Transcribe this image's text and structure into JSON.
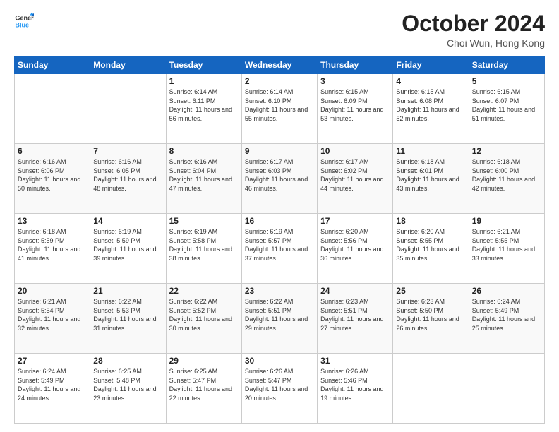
{
  "header": {
    "logo_line1": "General",
    "logo_line2": "Blue",
    "month": "October 2024",
    "location": "Choi Wun, Hong Kong"
  },
  "days_of_week": [
    "Sunday",
    "Monday",
    "Tuesday",
    "Wednesday",
    "Thursday",
    "Friday",
    "Saturday"
  ],
  "weeks": [
    [
      {
        "day": "",
        "info": ""
      },
      {
        "day": "",
        "info": ""
      },
      {
        "day": "1",
        "info": "Sunrise: 6:14 AM\nSunset: 6:11 PM\nDaylight: 11 hours and 56 minutes."
      },
      {
        "day": "2",
        "info": "Sunrise: 6:14 AM\nSunset: 6:10 PM\nDaylight: 11 hours and 55 minutes."
      },
      {
        "day": "3",
        "info": "Sunrise: 6:15 AM\nSunset: 6:09 PM\nDaylight: 11 hours and 53 minutes."
      },
      {
        "day": "4",
        "info": "Sunrise: 6:15 AM\nSunset: 6:08 PM\nDaylight: 11 hours and 52 minutes."
      },
      {
        "day": "5",
        "info": "Sunrise: 6:15 AM\nSunset: 6:07 PM\nDaylight: 11 hours and 51 minutes."
      }
    ],
    [
      {
        "day": "6",
        "info": "Sunrise: 6:16 AM\nSunset: 6:06 PM\nDaylight: 11 hours and 50 minutes."
      },
      {
        "day": "7",
        "info": "Sunrise: 6:16 AM\nSunset: 6:05 PM\nDaylight: 11 hours and 48 minutes."
      },
      {
        "day": "8",
        "info": "Sunrise: 6:16 AM\nSunset: 6:04 PM\nDaylight: 11 hours and 47 minutes."
      },
      {
        "day": "9",
        "info": "Sunrise: 6:17 AM\nSunset: 6:03 PM\nDaylight: 11 hours and 46 minutes."
      },
      {
        "day": "10",
        "info": "Sunrise: 6:17 AM\nSunset: 6:02 PM\nDaylight: 11 hours and 44 minutes."
      },
      {
        "day": "11",
        "info": "Sunrise: 6:18 AM\nSunset: 6:01 PM\nDaylight: 11 hours and 43 minutes."
      },
      {
        "day": "12",
        "info": "Sunrise: 6:18 AM\nSunset: 6:00 PM\nDaylight: 11 hours and 42 minutes."
      }
    ],
    [
      {
        "day": "13",
        "info": "Sunrise: 6:18 AM\nSunset: 5:59 PM\nDaylight: 11 hours and 41 minutes."
      },
      {
        "day": "14",
        "info": "Sunrise: 6:19 AM\nSunset: 5:59 PM\nDaylight: 11 hours and 39 minutes."
      },
      {
        "day": "15",
        "info": "Sunrise: 6:19 AM\nSunset: 5:58 PM\nDaylight: 11 hours and 38 minutes."
      },
      {
        "day": "16",
        "info": "Sunrise: 6:19 AM\nSunset: 5:57 PM\nDaylight: 11 hours and 37 minutes."
      },
      {
        "day": "17",
        "info": "Sunrise: 6:20 AM\nSunset: 5:56 PM\nDaylight: 11 hours and 36 minutes."
      },
      {
        "day": "18",
        "info": "Sunrise: 6:20 AM\nSunset: 5:55 PM\nDaylight: 11 hours and 35 minutes."
      },
      {
        "day": "19",
        "info": "Sunrise: 6:21 AM\nSunset: 5:55 PM\nDaylight: 11 hours and 33 minutes."
      }
    ],
    [
      {
        "day": "20",
        "info": "Sunrise: 6:21 AM\nSunset: 5:54 PM\nDaylight: 11 hours and 32 minutes."
      },
      {
        "day": "21",
        "info": "Sunrise: 6:22 AM\nSunset: 5:53 PM\nDaylight: 11 hours and 31 minutes."
      },
      {
        "day": "22",
        "info": "Sunrise: 6:22 AM\nSunset: 5:52 PM\nDaylight: 11 hours and 30 minutes."
      },
      {
        "day": "23",
        "info": "Sunrise: 6:22 AM\nSunset: 5:51 PM\nDaylight: 11 hours and 29 minutes."
      },
      {
        "day": "24",
        "info": "Sunrise: 6:23 AM\nSunset: 5:51 PM\nDaylight: 11 hours and 27 minutes."
      },
      {
        "day": "25",
        "info": "Sunrise: 6:23 AM\nSunset: 5:50 PM\nDaylight: 11 hours and 26 minutes."
      },
      {
        "day": "26",
        "info": "Sunrise: 6:24 AM\nSunset: 5:49 PM\nDaylight: 11 hours and 25 minutes."
      }
    ],
    [
      {
        "day": "27",
        "info": "Sunrise: 6:24 AM\nSunset: 5:49 PM\nDaylight: 11 hours and 24 minutes."
      },
      {
        "day": "28",
        "info": "Sunrise: 6:25 AM\nSunset: 5:48 PM\nDaylight: 11 hours and 23 minutes."
      },
      {
        "day": "29",
        "info": "Sunrise: 6:25 AM\nSunset: 5:47 PM\nDaylight: 11 hours and 22 minutes."
      },
      {
        "day": "30",
        "info": "Sunrise: 6:26 AM\nSunset: 5:47 PM\nDaylight: 11 hours and 20 minutes."
      },
      {
        "day": "31",
        "info": "Sunrise: 6:26 AM\nSunset: 5:46 PM\nDaylight: 11 hours and 19 minutes."
      },
      {
        "day": "",
        "info": ""
      },
      {
        "day": "",
        "info": ""
      }
    ]
  ]
}
